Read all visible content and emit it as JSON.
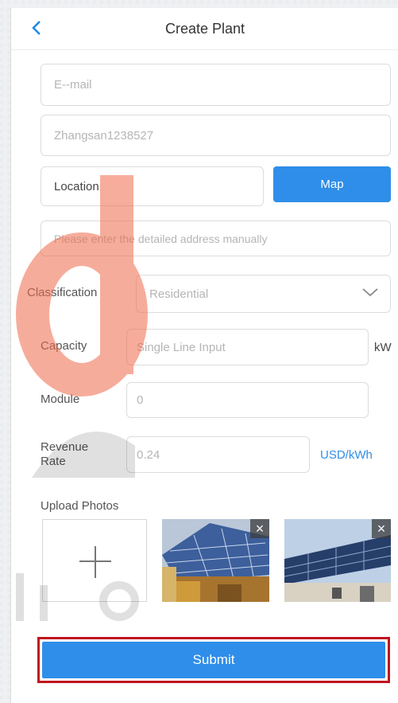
{
  "header": {
    "title": "Create Plant",
    "back_icon": "chevron-left-icon"
  },
  "form": {
    "email_placeholder": "E--mail",
    "username_value": "Zhangsan1238527",
    "location_label": "Location",
    "map_button": "Map",
    "address_placeholder": "Please enter the detailed address manually",
    "classification_label": "Classification",
    "classification_value": "Residential",
    "capacity_label": "Capacity",
    "capacity_placeholder": "Single Line Input",
    "capacity_unit": "kW",
    "module_label": "Module",
    "module_value": "0",
    "revenue_label_1": "Revenue",
    "revenue_label_2": "Rate",
    "revenue_value": "0.24",
    "revenue_unit": "USD/kWh",
    "upload_label": "Upload Photos",
    "remove_icon": "×",
    "submit_label": "Submit"
  },
  "colors": {
    "accent": "#2f8ee9",
    "highlight": "#c0141e",
    "watermark": "#e8422c"
  }
}
